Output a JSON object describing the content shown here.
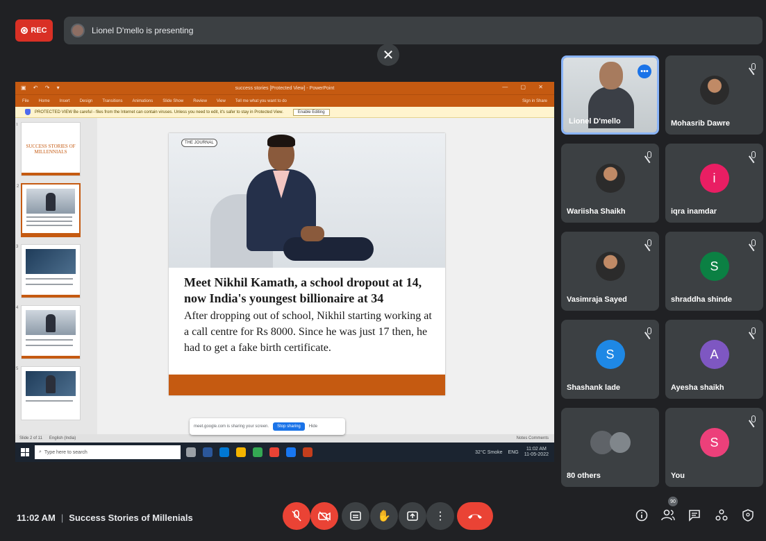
{
  "top": {
    "rec_label": "REC",
    "presenting_text": "Lionel D'mello is presenting",
    "close_symbol": "✕"
  },
  "ppt": {
    "title_bar": "success stories [Protected View] - PowerPoint",
    "ribbon_tabs": [
      "File",
      "Home",
      "Insert",
      "Design",
      "Transitions",
      "Animations",
      "Slide Show",
      "Review",
      "View",
      "Tell me what you want to do"
    ],
    "ribbon_right": "Sign in  Share",
    "protected_msg": "PROTECTED VIEW  Be careful - files from the Internet can contain viruses. Unless you need to edit, it's safer to stay in Protected View.",
    "enable_editing": "Enable Editing",
    "thumb1_title": "SUCCESS STORIES OF MILLENNIALS",
    "slide_logo": "THE JOURNAL",
    "slide_headline": "Meet Nikhil Kamath, a school dropout at 14, now India's youngest billionaire at 34",
    "slide_body": "After dropping out of school, Nikhil starting working at a call centre for Rs 8000. Since he was just 17 then, he had to get a fake birth certificate.",
    "status_left": "Slide 2 of 11",
    "status_mid": "English (India)",
    "status_right": "Notes   Comments",
    "sharing_text": "meet.google.com is sharing your screen.",
    "stop_sharing": "Stop sharing",
    "hide": "Hide",
    "taskbar_search": "Type here to search",
    "tray_weather": "32°C Smoke",
    "tray_lang": "ENG",
    "tray_time": "11:02 AM",
    "tray_date": "11-05-2022"
  },
  "participants": [
    {
      "name": "Lionel D'mello",
      "type": "camera",
      "speaking": true
    },
    {
      "name": "Mohasrib Dawre",
      "type": "photo"
    },
    {
      "name": "Wariisha Shaikh",
      "type": "photo"
    },
    {
      "name": "iqra inamdar",
      "type": "letter",
      "letter": "i",
      "color": "#e91e63"
    },
    {
      "name": "Vasimraja Sayed",
      "type": "photo"
    },
    {
      "name": "shraddha shinde",
      "type": "letter",
      "letter": "S",
      "color": "#0b8043"
    },
    {
      "name": "Shashank lade",
      "type": "letter",
      "letter": "S",
      "color": "#1e88e5"
    },
    {
      "name": "Ayesha shaikh",
      "type": "letter",
      "letter": "A",
      "color": "#7e57c2"
    },
    {
      "name": "80 others",
      "type": "group"
    },
    {
      "name": "You",
      "type": "letter",
      "letter": "S",
      "color": "#ec407a"
    }
  ],
  "bottom": {
    "time": "11:02 AM",
    "separator": "|",
    "meeting_title": "Success Stories of Millenials",
    "participant_count": "90"
  },
  "icons": {
    "mic": "mic-off-icon",
    "camera": "camera-off-icon",
    "captions": "captions-icon",
    "hand": "raise-hand-icon",
    "present": "present-icon",
    "more": "more-options-icon",
    "end": "end-call-icon",
    "info": "info-icon",
    "people": "people-icon",
    "chat": "chat-icon",
    "activities": "activities-icon",
    "host": "host-controls-icon"
  },
  "colors": {
    "meet_bg": "#202124",
    "tile_bg": "#3c4043",
    "ppt_accent": "#c55a11",
    "red": "#ea4335",
    "blue": "#1a73e8"
  }
}
